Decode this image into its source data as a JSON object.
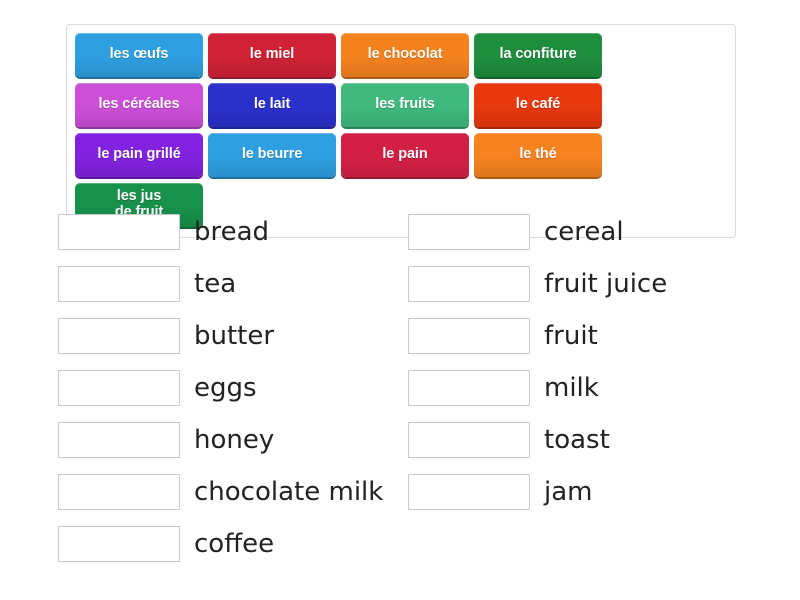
{
  "activity": {
    "type": "match-up",
    "language_pair": "French to English"
  },
  "word_bank": {
    "tiles": [
      {
        "label": "les œufs",
        "color": "#2e9fe0"
      },
      {
        "label": "le miel",
        "color": "#cf2235"
      },
      {
        "label": "le chocolat",
        "color": "#f4821f"
      },
      {
        "label": "la confiture",
        "color": "#1e8e3e"
      },
      {
        "label": "les céréales",
        "color": "#cc4fd8"
      },
      {
        "label": "le lait",
        "color": "#2b30cb"
      },
      {
        "label": "les fruits",
        "color": "#3fb97d"
      },
      {
        "label": "le café",
        "color": "#e8380d"
      },
      {
        "label": "le pain grillé",
        "color": "#8222e0"
      },
      {
        "label": "le beurre",
        "color": "#2e9fe0"
      },
      {
        "label": "le pain",
        "color": "#d41f45"
      },
      {
        "label": "le thé",
        "color": "#f68220"
      },
      {
        "label": "les jus\nde fruit",
        "color": "#17914b"
      }
    ]
  },
  "answers": {
    "left_column": [
      {
        "label": "bread",
        "value": ""
      },
      {
        "label": "tea",
        "value": ""
      },
      {
        "label": "butter",
        "value": ""
      },
      {
        "label": "eggs",
        "value": ""
      },
      {
        "label": "honey",
        "value": ""
      },
      {
        "label": "chocolate milk",
        "value": ""
      },
      {
        "label": "coffee",
        "value": ""
      }
    ],
    "right_column": [
      {
        "label": "cereal",
        "value": ""
      },
      {
        "label": "fruit juice",
        "value": ""
      },
      {
        "label": "fruit",
        "value": ""
      },
      {
        "label": "milk",
        "value": ""
      },
      {
        "label": "toast",
        "value": ""
      },
      {
        "label": "jam",
        "value": ""
      }
    ]
  },
  "style": {
    "bank_border_color": "#dcdcdc",
    "box_border_color": "#c8c8c8",
    "text_color": "#222222",
    "page_background": "#ffffff"
  }
}
